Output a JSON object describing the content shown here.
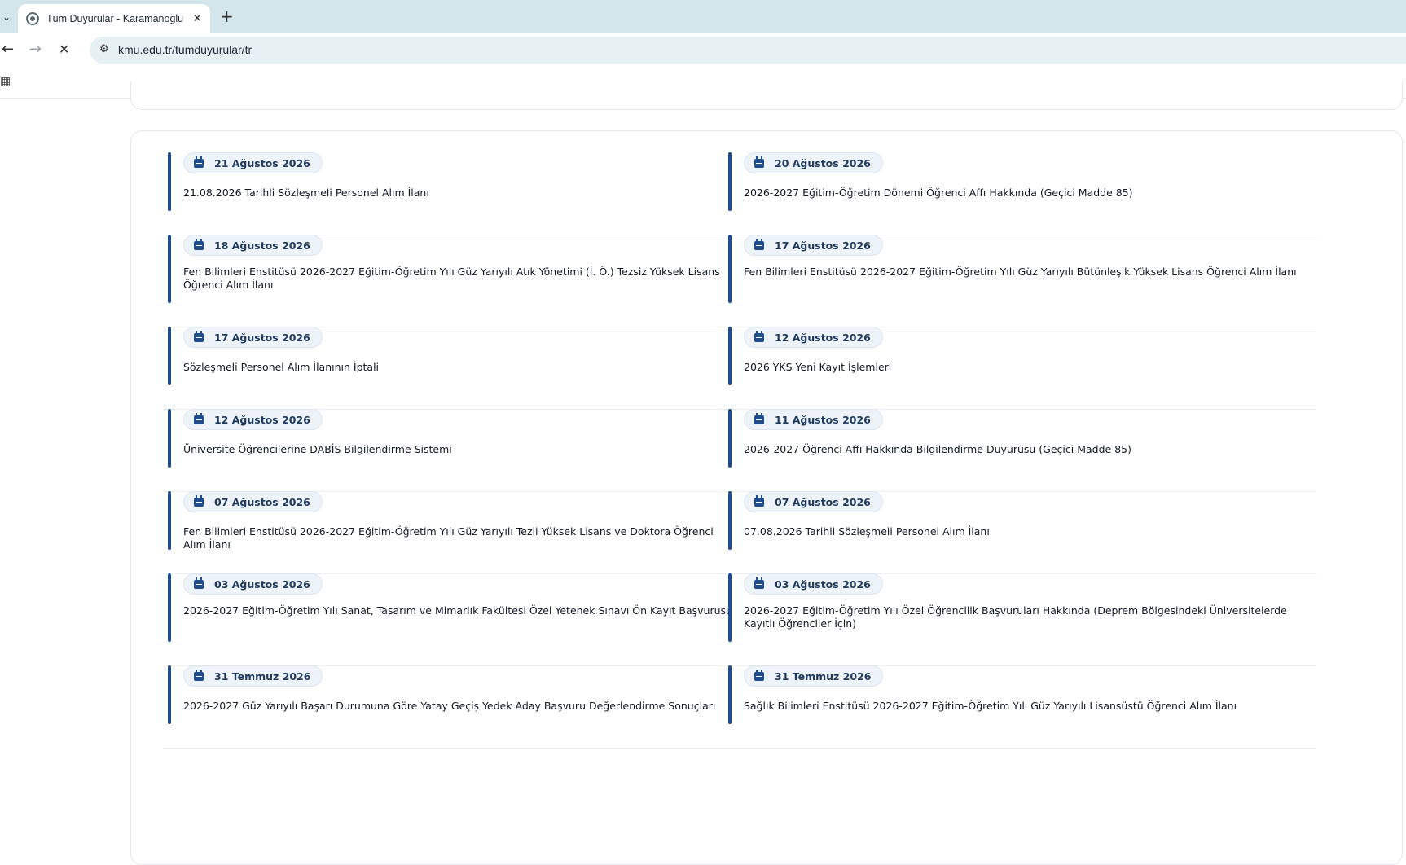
{
  "browser": {
    "tab_title": "Tüm Duyurular - Karamanoğlu Mehmetbey Üniversitesi",
    "url": "kmu.edu.tr/tumduyurular/tr",
    "icons": [
      "chevron-down-icon",
      "favicon-icon",
      "close-icon",
      "plus-icon",
      "back-icon",
      "forward-icon",
      "stop-icon",
      "site-info-icon",
      "apps-icon",
      "calendar-icon"
    ]
  },
  "announcements": [
    {
      "date": "21 Ağustos 2026",
      "title": "21.08.2026 Tarihli Sözleşmeli Personel Alım İlanı"
    },
    {
      "date": "20 Ağustos 2026",
      "title": "2026-2027 Eğitim-Öğretim Dönemi Öğrenci Affı Hakkında (Geçici Madde 85)"
    },
    {
      "date": "18 Ağustos 2026",
      "title": "Fen Bilimleri Enstitüsü 2026-2027 Eğitim-Öğretim Yılı Güz Yarıyılı Atık Yönetimi (İ. Ö.) Tezsiz Yüksek Lisans Öğrenci Alım İlanı"
    },
    {
      "date": "17 Ağustos 2026",
      "title": "Fen Bilimleri Enstitüsü 2026-2027 Eğitim-Öğretim Yılı Güz Yarıyılı Bütünleşik Yüksek Lisans Öğrenci Alım İlanı"
    },
    {
      "date": "17 Ağustos 2026",
      "title": "Sözleşmeli Personel Alım İlanının İptali"
    },
    {
      "date": "12 Ağustos 2026",
      "title": "2026 YKS Yeni Kayıt İşlemleri"
    },
    {
      "date": "12 Ağustos 2026",
      "title": "Üniversite Öğrencilerine DABİS Bilgilendirme Sistemi"
    },
    {
      "date": "11 Ağustos 2026",
      "title": "2026-2027 Öğrenci Affı Hakkında Bilgilendirme Duyurusu (Geçici Madde 85)"
    },
    {
      "date": "07 Ağustos 2026",
      "title": "Fen Bilimleri Enstitüsü 2026-2027 Eğitim-Öğretim Yılı Güz Yarıyılı Tezli Yüksek Lisans ve Doktora Öğrenci Alım İlanı"
    },
    {
      "date": "07 Ağustos 2026",
      "title": "07.08.2026 Tarihli Sözleşmeli Personel Alım İlanı"
    },
    {
      "date": "03 Ağustos 2026",
      "title": "2026-2027 Eğitim-Öğretim Yılı Sanat, Tasarım ve Mimarlık Fakültesi Özel Yetenek Sınavı Ön Kayıt Başvurusu"
    },
    {
      "date": "03 Ağustos 2026",
      "title": "2026-2027 Eğitim-Öğretim Yılı Özel Öğrencilik Başvuruları Hakkında (Deprem Bölgesindeki Üniversitelerde Kayıtlı Öğrenciler İçin)"
    },
    {
      "date": "31 Temmuz 2026",
      "title": "2026-2027 Güz Yarıyılı Başarı Durumuna Göre Yatay Geçiş Yedek Aday Başvuru Değerlendirme Sonuçları"
    },
    {
      "date": "31 Temmuz 2026",
      "title": "Sağlık Bilimleri Enstitüsü 2026-2027 Eğitim-Öğretim Yılı Güz Yarıyılı Lisansüstü Öğrenci Alım İlanı"
    }
  ]
}
